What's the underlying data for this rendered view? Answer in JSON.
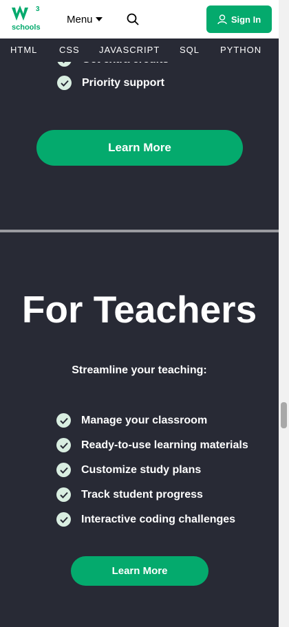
{
  "header": {
    "logo_text": "schools",
    "logo_sup": "3",
    "menu_label": "Menu",
    "signin_label": "Sign In"
  },
  "nav": {
    "items": [
      "HTML",
      "CSS",
      "JAVASCRIPT",
      "SQL",
      "PYTHON"
    ]
  },
  "prev_section": {
    "partial_item": "Get extra credits",
    "items": [
      "Priority support"
    ],
    "button_label": "Learn More"
  },
  "teachers": {
    "title": "For Teachers",
    "subtitle": "Streamline your teaching:",
    "items": [
      "Manage your classroom",
      "Ready-to-use learning materials",
      "Customize study plans",
      "Track student progress",
      "Interactive coding challenges"
    ],
    "button_label": "Learn More"
  },
  "colors": {
    "accent": "#04aa6d",
    "background": "#282a35",
    "check_bg": "#d9eee1"
  }
}
